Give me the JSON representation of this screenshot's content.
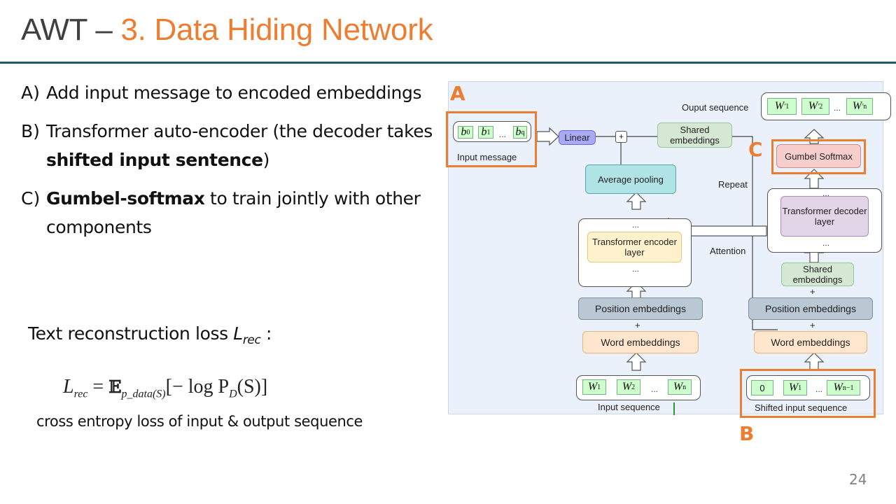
{
  "slide": {
    "title_prefix": "AWT – ",
    "title_accent": "3. Data Hiding Network",
    "page_number": "24",
    "colors": {
      "accent": "#ED7D31",
      "rule": "#1F5C6B",
      "diagram_bg": "#EAF1FB"
    }
  },
  "bullets": [
    {
      "mark": "A)",
      "text_before": "Add input message to encoded embeddings",
      "bold": "",
      "text_after": ""
    },
    {
      "mark": "B)",
      "text_before": "Transformer auto-encoder (the decoder takes ",
      "bold": "shifted input sentence",
      "text_after": ")"
    },
    {
      "mark": "C)",
      "text_before": " ",
      "bold": "Gumbel-softmax",
      "text_after": " to train jointly with other components"
    }
  ],
  "loss": {
    "label": "Text reconstruction loss ",
    "symbol": "L",
    "symbol_sub": "rec",
    "colon": " :",
    "formula": {
      "lhs": "L",
      "lhs_sub": "rec",
      "eq": " = ",
      "expect": "𝔼",
      "expect_sub": "p_data(S)",
      "body": "[− log P",
      "body_sub": "D",
      "tail": "(S)]"
    },
    "caption": "cross entropy loss of input & output sequence"
  },
  "diagram": {
    "section_labels": {
      "a": "A",
      "b": "B",
      "c": "C"
    },
    "input_message": {
      "label": "Input message",
      "tokens": [
        {
          "base": "b",
          "sub": "0"
        },
        {
          "base": "b",
          "sub": "1"
        },
        {
          "base": "b",
          "sub": "q"
        }
      ],
      "ellipsis": "..."
    },
    "linear": "Linear",
    "plus": "+",
    "shared_embeddings_top": "Shared embeddings",
    "average_pooling": "Average pooling",
    "encoder_layer": "Transformer encoder layer",
    "encoder_dots": "...",
    "attention_label": "Attention",
    "repeat_label": "Repeat",
    "left_position_embeddings": "Position embeddings",
    "left_word_embeddings": "Word embeddings",
    "input_sequence": {
      "label": "Input sequence",
      "tokens": [
        {
          "base": "W",
          "sub": "1"
        },
        {
          "base": "W",
          "sub": "2"
        },
        {
          "base": "W",
          "sub": "n"
        }
      ],
      "ellipsis": "..."
    },
    "output_sequence": {
      "label": "Ouput sequence",
      "tokens": [
        {
          "base": "W",
          "sup": "′",
          "sub": "1"
        },
        {
          "base": "W",
          "sup": "′",
          "sub": "2"
        },
        {
          "base": "W",
          "sup": "′",
          "sub": "n"
        }
      ],
      "ellipsis": "..."
    },
    "gumbel_softmax": "Gumbel Softmax",
    "decoder_layer": "Transformer decoder layer",
    "shared_embeddings_bottom": "Shared embeddings",
    "right_position_embeddings": "Position embeddings",
    "right_word_embeddings": "Word embeddings",
    "shifted_sequence": {
      "label": "Shifted input sequence",
      "tokens": [
        {
          "base": "0",
          "sub": ""
        },
        {
          "base": "W",
          "sub": "1"
        },
        {
          "base": "W",
          "sub": "n−1"
        }
      ],
      "ellipsis": "..."
    },
    "colors": {
      "token": "#CCFFCC",
      "linear": "#A9A9F5",
      "shared": "#D5E8D4",
      "pooling": "#B0E3E6",
      "encoder": "#FFF2CC",
      "decoder": "#E1D5E7",
      "gumbel": "#F8CECC",
      "position": "#BAC8D3",
      "word": "#FFE6CC"
    }
  }
}
